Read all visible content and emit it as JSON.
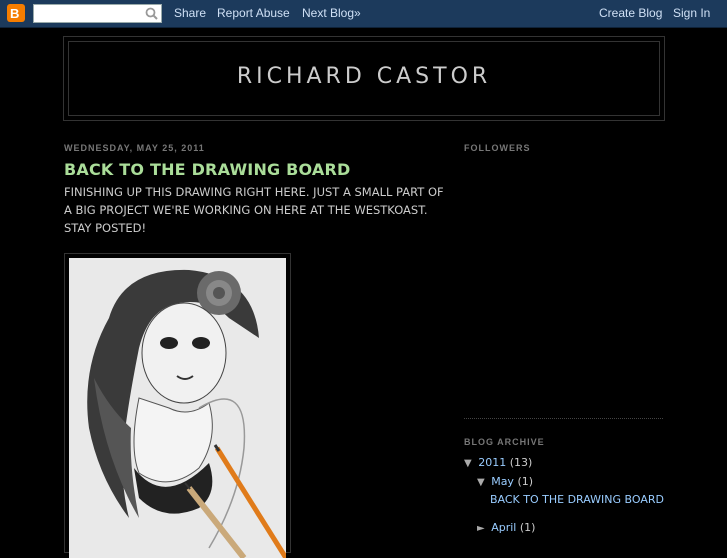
{
  "navbar": {
    "search": {
      "value": "",
      "placeholder": ""
    },
    "links": {
      "share": "Share",
      "report_abuse": "Report Abuse",
      "next_blog": "Next Blog»"
    },
    "right_links": {
      "create_blog": "Create Blog",
      "sign_in": "Sign In"
    }
  },
  "header": {
    "title": "RICHARD CASTOR"
  },
  "post": {
    "date": "WEDNESDAY, MAY 25, 2011",
    "title": "BACK TO THE DRAWING BOARD",
    "body": "FINISHING UP THIS DRAWING RIGHT HERE. JUST A SMALL PART OF A BIG PROJECT WE'RE WORKING ON HERE AT THE WESTKOAST. STAY POSTED!"
  },
  "sidebar": {
    "followers_heading": "FOLLOWERS",
    "archive_heading": "BLOG ARCHIVE",
    "archive": [
      {
        "expanded": true,
        "label": "2011",
        "count": "(13)"
      },
      {
        "expanded": true,
        "label": "May",
        "count": "(1)"
      },
      {
        "post": "BACK TO THE DRAWING BOARD"
      },
      {
        "expanded": false,
        "label": "April",
        "count": "(1)"
      }
    ]
  },
  "colors": {
    "navbar": "#1c3a5c",
    "post_title": "#aadd99",
    "link": "#99ccff",
    "logo": "#f57d00"
  }
}
